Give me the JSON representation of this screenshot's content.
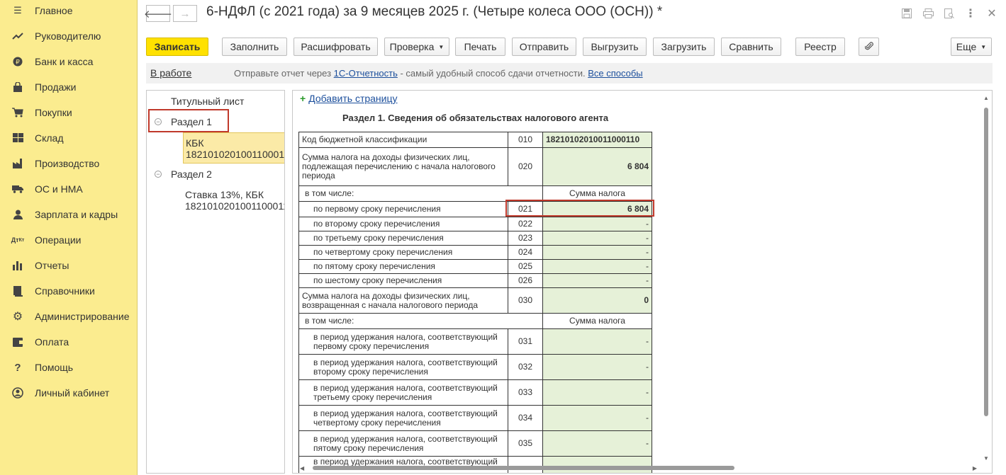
{
  "sidebar": {
    "items": [
      {
        "label": "Главное",
        "icon": "menu-icon"
      },
      {
        "label": "Руководителю",
        "icon": "chart-trend-icon"
      },
      {
        "label": "Банк и касса",
        "icon": "coin-icon"
      },
      {
        "label": "Продажи",
        "icon": "shopping-bag-icon"
      },
      {
        "label": "Покупки",
        "icon": "cart-icon"
      },
      {
        "label": "Склад",
        "icon": "warehouse-icon"
      },
      {
        "label": "Производство",
        "icon": "factory-icon"
      },
      {
        "label": "ОС и НМА",
        "icon": "truck-icon"
      },
      {
        "label": "Зарплата и кадры",
        "icon": "person-icon"
      },
      {
        "label": "Операции",
        "icon": "dt-kt-icon"
      },
      {
        "label": "Отчеты",
        "icon": "bar-chart-icon"
      },
      {
        "label": "Справочники",
        "icon": "book-icon"
      },
      {
        "label": "Администрирование",
        "icon": "gear-icon"
      },
      {
        "label": "Оплата",
        "icon": "wallet-icon"
      },
      {
        "label": "Помощь",
        "icon": "question-icon"
      },
      {
        "label": "Личный кабинет",
        "icon": "account-icon"
      }
    ]
  },
  "header": {
    "title": "6-НДФЛ (с 2021 года) за 9 месяцев 2025 г. (Четыре колеса ООО (ОСН)) *",
    "back_glyph": "🡐",
    "forward_glyph": "→"
  },
  "toolbar": {
    "save": "Записать",
    "fill": "Заполнить",
    "decode": "Расшифровать",
    "check": "Проверка",
    "print": "Печать",
    "send": "Отправить",
    "export": "Выгрузить",
    "import": "Загрузить",
    "compare": "Сравнить",
    "registry": "Реестр",
    "more": "Еще"
  },
  "status": {
    "label": "В работе",
    "msg_prefix": "Отправьте отчет через ",
    "msg_link": "1С-Отчетность",
    "msg_middle": " - самый удобный способ сдачи отчетности. ",
    "msg_link2": "Все способы"
  },
  "tree": {
    "title_page": "Титульный лист",
    "section1": "Раздел 1",
    "section1_child_line1": "КБК",
    "section1_child_line2": "18210102010011000110",
    "section2": "Раздел 2",
    "section2_child_line1": "Ставка 13%, КБК",
    "section2_child_line2": "18210102010011000110"
  },
  "form": {
    "add_page": "Добавить страницу",
    "section_title": "Раздел 1. Сведения об обязательствах налогового агента",
    "rows": [
      {
        "desc": "Код бюджетной классификации",
        "code": "010",
        "value": "18210102010011000110"
      },
      {
        "desc": "Сумма налога на доходы физических лиц, подлежащая перечислению с начала налогового периода",
        "code": "020",
        "value": "6 804"
      },
      {
        "desc": "в том числе:",
        "value": "Сумма налога"
      },
      {
        "desc": "по первому сроку перечисления",
        "code": "021",
        "value": "6 804"
      },
      {
        "desc": "по второму сроку перечисления",
        "code": "022",
        "value": "-"
      },
      {
        "desc": "по третьему сроку перечисления",
        "code": "023",
        "value": "-"
      },
      {
        "desc": "по четвертому сроку перечисления",
        "code": "024",
        "value": "-"
      },
      {
        "desc": "по пятому сроку перечисления",
        "code": "025",
        "value": "-"
      },
      {
        "desc": "по шестому сроку перечисления",
        "code": "026",
        "value": "-"
      },
      {
        "desc": "Сумма налога на доходы физических лиц, возвращенная с начала налогового периода",
        "code": "030",
        "value": "0"
      },
      {
        "desc": "в том числе:",
        "value": "Сумма налога"
      },
      {
        "desc": "в период удержания налога, соответствующий первому сроку перечисления",
        "code": "031",
        "value": "-"
      },
      {
        "desc": "в период удержания налога, соответствующий второму сроку перечисления",
        "code": "032",
        "value": "-"
      },
      {
        "desc": "в период удержания налога, соответствующий третьему сроку перечисления",
        "code": "033",
        "value": "-"
      },
      {
        "desc": "в период удержания налога, соответствующий четвертому сроку перечисления",
        "code": "034",
        "value": "-"
      },
      {
        "desc": "в период удержания налога, соответствующий пятому сроку перечисления",
        "code": "035",
        "value": "-"
      },
      {
        "desc": "в период удержания налога, соответствующий"
      }
    ]
  },
  "colors": {
    "sidebar_bg": "#fbec8f",
    "primary_button": "#ffe100",
    "highlight_border": "#c0392b",
    "value_cell_bg": "#e6f1d8",
    "link": "#1c4f9c"
  }
}
